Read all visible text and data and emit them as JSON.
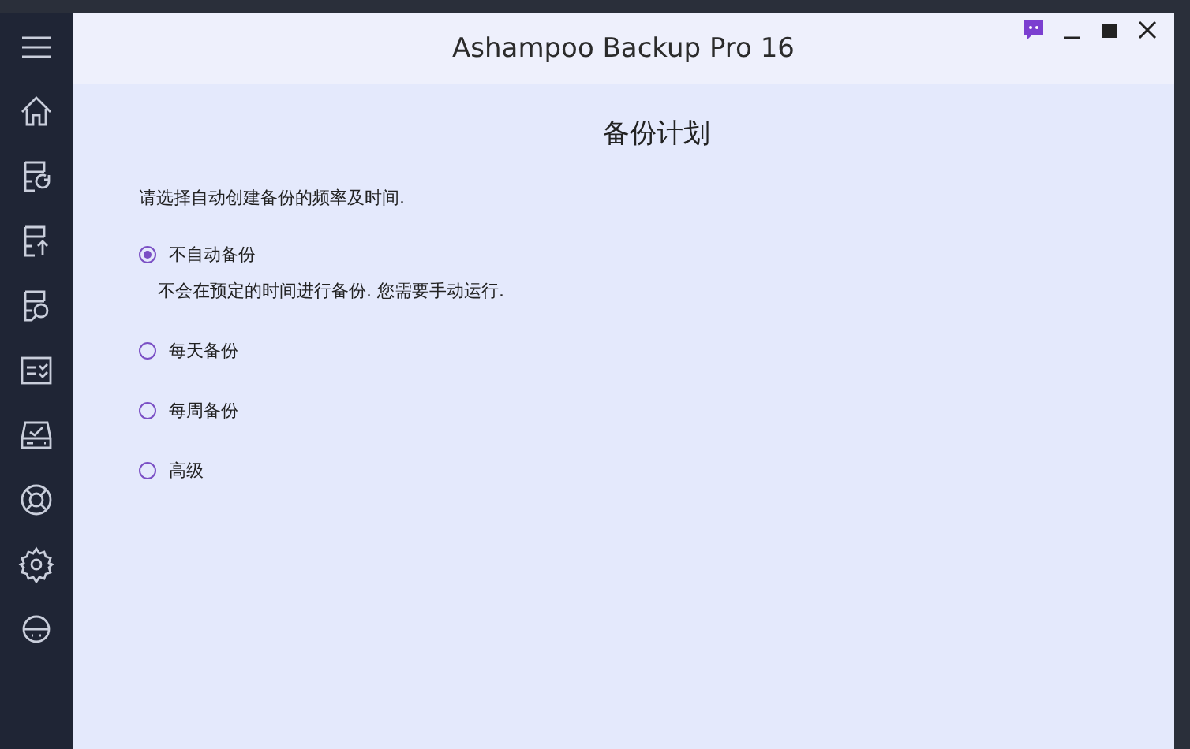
{
  "window": {
    "title": "Ashampoo Backup Pro 16"
  },
  "page": {
    "heading": "备份计划",
    "instruction": "请选择自动创建备份的频率及时间."
  },
  "options": [
    {
      "label": "不自动备份",
      "selected": true,
      "description": "不会在预定的时间进行备份. 您需要手动运行."
    },
    {
      "label": "每天备份",
      "selected": false
    },
    {
      "label": "每周备份",
      "selected": false
    },
    {
      "label": "高级",
      "selected": false
    }
  ]
}
